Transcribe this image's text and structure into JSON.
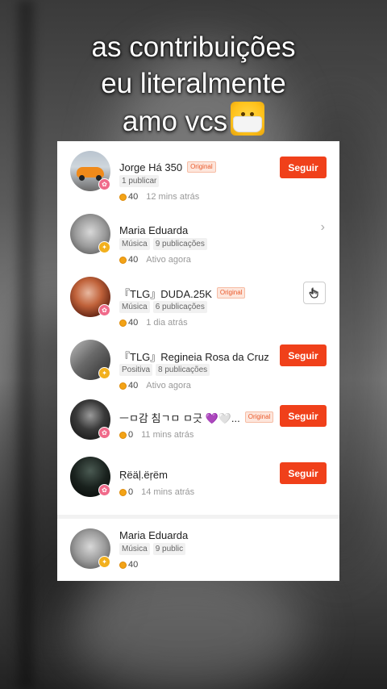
{
  "caption": {
    "line1": "as contribuições",
    "line2": "eu literalmente",
    "line3": "amo vcs",
    "emoji": "mask-emoji"
  },
  "colors": {
    "accent": "#f0401a",
    "coin": "#f3a316",
    "badge_pink": "#f06a8a",
    "badge_gold": "#f2b01e"
  },
  "users": [
    {
      "name": "Jorge Há 350",
      "original": "Original",
      "tags": [
        "1 publicar"
      ],
      "coins": "40",
      "time": "12 mins atrás",
      "action": "Seguir"
    },
    {
      "name": "Maria Eduarda",
      "tags": [
        "Música",
        "9 publicações"
      ],
      "coins": "40",
      "time": "Ativo agora",
      "action": "chevron-right-icon"
    },
    {
      "name": "『TLG』DUDA.25K",
      "original": "Original",
      "tags": [
        "Música",
        "6 publicações"
      ],
      "coins": "40",
      "time": "1 dia atrás",
      "action": "hand-icon"
    },
    {
      "name": "『TLG』Regineia Rosa da Cruz",
      "tags": [
        "Positiva",
        "8 publicações"
      ],
      "coins": "40",
      "time": "Ativo agora",
      "action": "Seguir"
    },
    {
      "name": "ㅡㅁ감 침ㄱㅁ ㅁ긋 💜🤍...",
      "original": "Original",
      "coins": "0",
      "time": "11 mins atrás",
      "action": "Seguir"
    },
    {
      "name": "Ŗëäļ.ëŗëm",
      "coins": "0",
      "time": "14 mins atrás",
      "action": "Seguir"
    }
  ],
  "footer_user": {
    "name": "Maria Eduarda",
    "tags": [
      "Música",
      "9 public"
    ],
    "coins": "40"
  }
}
